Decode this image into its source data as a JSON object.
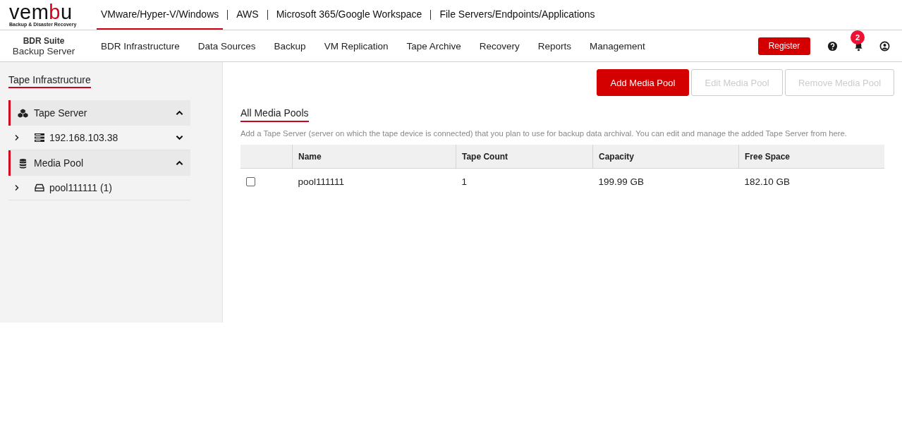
{
  "logo": {
    "start": "vem",
    "highlight": "b",
    "end": "u",
    "tagline": "Backup & Disaster Recovery"
  },
  "product_tabs": [
    {
      "label": "VMware/Hyper-V/Windows",
      "selected": true
    },
    {
      "label": "AWS",
      "selected": false
    },
    {
      "label": "Microsoft 365/Google Workspace",
      "selected": false
    },
    {
      "label": "File Servers/Endpoints/Applications",
      "selected": false
    }
  ],
  "suite": {
    "name": "BDR Suite",
    "role": "Backup Server"
  },
  "nav": [
    {
      "label": "BDR Infrastructure",
      "selected": false
    },
    {
      "label": "Data Sources",
      "selected": false
    },
    {
      "label": "Backup",
      "selected": false
    },
    {
      "label": "VM Replication",
      "selected": false
    },
    {
      "label": "Tape Archive",
      "selected": false
    },
    {
      "label": "Recovery",
      "selected": false
    },
    {
      "label": "Reports",
      "selected": false
    },
    {
      "label": "Management",
      "selected": false
    }
  ],
  "register_button": "Register",
  "notification_count": "2",
  "sidebar": {
    "title": "Tape Infrastructure",
    "sections": [
      {
        "label": "Tape Server",
        "kind": "server",
        "expanded": true,
        "children": [
          {
            "label": "192.168.103.38",
            "kind": "host",
            "expanded": false
          }
        ]
      },
      {
        "label": "Media Pool",
        "kind": "pool",
        "expanded": true,
        "children": [
          {
            "label": "pool111111 (1)",
            "kind": "drive"
          }
        ]
      }
    ]
  },
  "actions": [
    {
      "label": "Add Media Pool",
      "disabled": false
    },
    {
      "label": "Edit Media Pool",
      "disabled": true
    },
    {
      "label": "Remove Media Pool",
      "disabled": true
    }
  ],
  "view_tab": "All Media Pools",
  "description": "Add a Tape Server (server on which the tape device is connected) that you plan to use for backup data archival. You can edit and manage the added Tape Server from here.",
  "table": {
    "columns": [
      "Name",
      "Tape Count",
      "Capacity",
      "Free Space"
    ],
    "rows": [
      {
        "checked": false,
        "cells": [
          "pool111111",
          "1",
          "199.99 GB",
          "182.10 GB"
        ]
      }
    ]
  }
}
